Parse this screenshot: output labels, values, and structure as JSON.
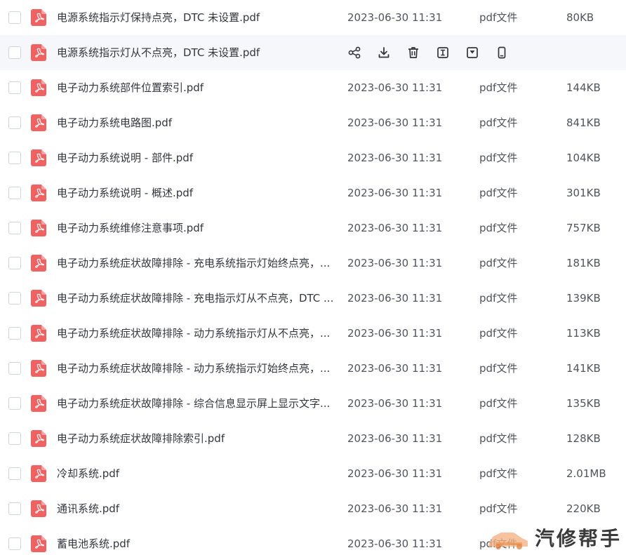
{
  "files": [
    {
      "name": "电源系统指示灯保持点亮，DTC 未设置.pdf",
      "date": "2023-06-30 11:31",
      "type": "pdf文件",
      "size": "80KB"
    },
    {
      "name": "电源系统指示灯从不点亮，DTC 未设置.pdf",
      "date": "",
      "type": "",
      "size": ""
    },
    {
      "name": "电子动力系统部件位置索引.pdf",
      "date": "2023-06-30 11:31",
      "type": "pdf文件",
      "size": "144KB"
    },
    {
      "name": "电子动力系统电路图.pdf",
      "date": "2023-06-30 11:31",
      "type": "pdf文件",
      "size": "841KB"
    },
    {
      "name": "电子动力系统说明 - 部件.pdf",
      "date": "2023-06-30 11:31",
      "type": "pdf文件",
      "size": "104KB"
    },
    {
      "name": "电子动力系统说明 - 概述.pdf",
      "date": "2023-06-30 11:31",
      "type": "pdf文件",
      "size": "301KB"
    },
    {
      "name": "电子动力系统维修注意事项.pdf",
      "date": "2023-06-30 11:31",
      "type": "pdf文件",
      "size": "757KB"
    },
    {
      "name": "电子动力系统症状故障排除 - 充电系统指示灯始终点亮，...",
      "date": "2023-06-30 11:31",
      "type": "pdf文件",
      "size": "181KB"
    },
    {
      "name": "电子动力系统症状故障排除 - 充电指示灯从不点亮，DTC ...",
      "date": "2023-06-30 11:31",
      "type": "pdf文件",
      "size": "139KB"
    },
    {
      "name": "电子动力系统症状故障排除 - 动力系统指示灯从不点亮，...",
      "date": "2023-06-30 11:31",
      "type": "pdf文件",
      "size": "113KB"
    },
    {
      "name": "电子动力系统症状故障排除 - 动力系统指示灯始终点亮，...",
      "date": "2023-06-30 11:31",
      "type": "pdf文件",
      "size": "141KB"
    },
    {
      "name": "电子动力系统症状故障排除 - 综合信息显示屏上显示文字...",
      "date": "2023-06-30 11:31",
      "type": "pdf文件",
      "size": "135KB"
    },
    {
      "name": "电子动力系统症状故障排除索引.pdf",
      "date": "2023-06-30 11:31",
      "type": "pdf文件",
      "size": "128KB"
    },
    {
      "name": "冷却系统.pdf",
      "date": "2023-06-30 11:31",
      "type": "pdf文件",
      "size": "2.01MB"
    },
    {
      "name": "通讯系统.pdf",
      "date": "2023-06-30 11:31",
      "type": "pdf文件",
      "size": "220KB"
    },
    {
      "name": "蓄电池系统.pdf",
      "date": "2023-06-30 11:31",
      "type": "pdf文件",
      "size": ""
    }
  ],
  "hover_row_index": 1,
  "hover_actions": [
    "share-icon",
    "download-icon",
    "delete-icon",
    "rename-icon",
    "move-icon",
    "phone-icon"
  ],
  "watermark": {
    "text": "汽修帮手"
  },
  "colors": {
    "pdf_red": "#f06262",
    "hover_bg": "#f6f7fa",
    "text": "#33363d",
    "muted": "#50545c"
  }
}
